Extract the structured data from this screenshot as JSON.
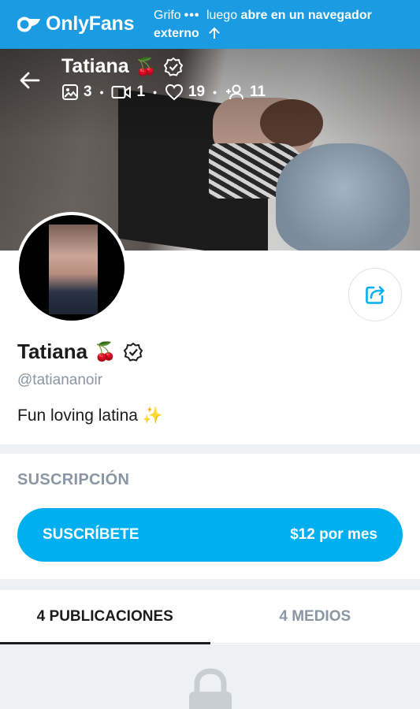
{
  "banner": {
    "brand": "OnlyFans",
    "msg_part1": "Grifo",
    "msg_dots": "•••",
    "msg_part2": "luego",
    "msg_bold": "abre en un navegador externo"
  },
  "cover": {
    "name": "Tatiana",
    "emoji": "🍒",
    "stats": {
      "photos": "3",
      "videos": "1",
      "likes": "19",
      "fans": "11"
    }
  },
  "profile": {
    "name": "Tatiana",
    "emoji": "🍒",
    "handle": "@tatiananoir",
    "bio": "Fun loving latina ✨"
  },
  "subscription": {
    "title": "SUSCRIPCIÓN",
    "button_label": "SUSCRÍBETE",
    "price": "$12 por mes"
  },
  "tabs": [
    {
      "label": "4 PUBLICACIONES",
      "active": true
    },
    {
      "label": "4 MEDIOS",
      "active": false
    }
  ],
  "colors": {
    "banner": "#1b9be2",
    "accent": "#00aff0",
    "muted": "#8a96a3"
  },
  "icons": [
    "onlyfans-logo-icon",
    "arrow-up-icon",
    "back-arrow-icon",
    "verified-icon",
    "image-icon",
    "video-icon",
    "heart-icon",
    "fans-icon",
    "share-icon",
    "lock-icon"
  ]
}
